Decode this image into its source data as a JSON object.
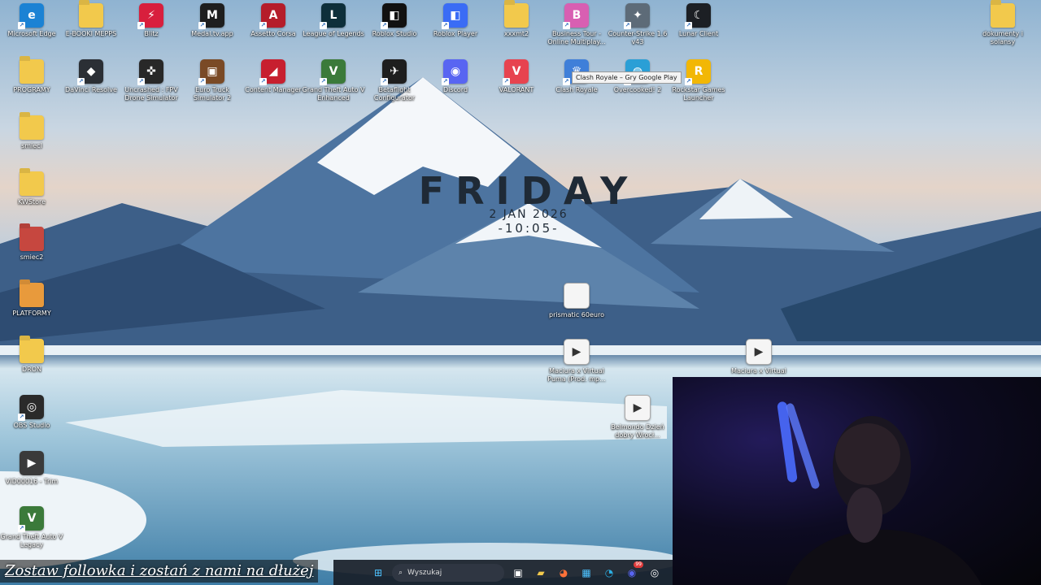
{
  "desktop": {
    "clock": {
      "day": "FRIDAY",
      "date": "2 JAN 2026",
      "time": "-10:05-"
    },
    "tooltip": "Clash Royale – Gry Google Play",
    "icons": [
      {
        "label": "Microsoft Edge",
        "icon": "edge-icon",
        "color": "#1b82d4",
        "glyph": "e"
      },
      {
        "label": "E-BOOKI MEPPS",
        "icon": "folder-icon",
        "color": "#f2c94c",
        "glyph": ""
      },
      {
        "label": "Blitz",
        "icon": "blitz-icon",
        "color": "#d81f3d",
        "glyph": "⚡"
      },
      {
        "label": "Medal.tv.app",
        "icon": "medal-icon",
        "color": "#1e1e1e",
        "glyph": "M"
      },
      {
        "label": "Assetto Corsa",
        "icon": "assetto-corsa-icon",
        "color": "#b51d2a",
        "glyph": "A"
      },
      {
        "label": "League of Legends",
        "icon": "league-icon",
        "color": "#0e2f3a",
        "glyph": "L"
      },
      {
        "label": "Roblox Studio",
        "icon": "roblox-studio-icon",
        "color": "#111111",
        "glyph": "◧"
      },
      {
        "label": "Roblox Player",
        "icon": "roblox-player-icon",
        "color": "#3a6cf5",
        "glyph": "◧"
      },
      {
        "label": "xxxmt2",
        "icon": "folder-icon",
        "color": "#f2c94c",
        "glyph": ""
      },
      {
        "label": "Business Tour - Online Multiplay...",
        "icon": "business-tour-icon",
        "color": "#d85fb2",
        "glyph": "B"
      },
      {
        "label": "Counter-Strike 1.6 v43",
        "icon": "counter-strike-icon",
        "color": "#5d6b78",
        "glyph": "✦"
      },
      {
        "label": "Lunar Client",
        "icon": "lunar-client-icon",
        "color": "#1c1f24",
        "glyph": "☾"
      },
      {
        "label": "PROGRAMY",
        "icon": "folder-icon",
        "color": "#f2c94c",
        "glyph": ""
      },
      {
        "label": "DaVinci Resolve",
        "icon": "davinci-icon",
        "color": "#2b2f35",
        "glyph": "◆"
      },
      {
        "label": "Uncrashed : FPV Drone Simulator",
        "icon": "uncrashed-icon",
        "color": "#282828",
        "glyph": "✜"
      },
      {
        "label": "Euro Truck Simulator 2",
        "icon": "ets2-icon",
        "color": "#7a4a26",
        "glyph": "▣"
      },
      {
        "label": "Content Manager",
        "icon": "content-manager-icon",
        "color": "#c71f2f",
        "glyph": "◢"
      },
      {
        "label": "Grand Theft Auto V Enhanced",
        "icon": "gta5-icon",
        "color": "#3b7a3a",
        "glyph": "V"
      },
      {
        "label": "Betaflight Configurator",
        "icon": "betaflight-icon",
        "color": "#1e1e1e",
        "glyph": "✈"
      },
      {
        "label": "Discord",
        "icon": "discord-icon",
        "color": "#5865f2",
        "glyph": "◉"
      },
      {
        "label": "VALORANT",
        "icon": "valorant-icon",
        "color": "#e7434f",
        "glyph": "V"
      },
      {
        "label": "Clash Royale",
        "icon": "clash-royale-icon",
        "color": "#3f7fd9",
        "glyph": "♛"
      },
      {
        "label": "Overcooked! 2",
        "icon": "overcooked-icon",
        "color": "#2a9fd6",
        "glyph": "◍"
      },
      {
        "label": "Rockstar Games Launcher",
        "icon": "rockstar-icon",
        "color": "#f2b705",
        "glyph": "R"
      },
      {
        "label": "smiecI",
        "icon": "folder-icon",
        "color": "#f2c94c",
        "glyph": ""
      },
      {
        "label": "KWStore",
        "icon": "folder-icon",
        "color": "#f2c94c",
        "glyph": ""
      },
      {
        "label": "smiec2",
        "icon": "image-folder-icon",
        "color": "#c6473f",
        "glyph": ""
      },
      {
        "label": "PLATFORMY",
        "icon": "platform-folder-icon",
        "color": "#e89a3c",
        "glyph": ""
      },
      {
        "label": "DRON",
        "icon": "folder-icon",
        "color": "#f2c94c",
        "glyph": ""
      },
      {
        "label": "OBS Studio",
        "icon": "obs-icon",
        "color": "#2a2a2a",
        "glyph": "◎"
      },
      {
        "label": "VID00016 - Trim",
        "icon": "video-file-icon",
        "color": "#3a3a3a",
        "glyph": "▶"
      },
      {
        "label": "Grand Theft Auto V Legacy",
        "icon": "gta5-legacy-icon",
        "color": "#3b7a3a",
        "glyph": "V"
      },
      {
        "label": "dokumenty i solansy",
        "icon": "folder-icon",
        "color": "#f2c94c",
        "glyph": ""
      },
      {
        "label": "prismatic 60euro",
        "icon": "text-file-icon",
        "color": "#f5f5f5",
        "glyph": ""
      },
      {
        "label": "Maciura x Virtual Puma (Prod. mp...",
        "icon": "media-file-icon",
        "color": "#f5f5f5",
        "glyph": "▶"
      },
      {
        "label": "Maciura x Virtual",
        "icon": "media-file-icon",
        "color": "#f5f5f5",
        "glyph": "▶"
      },
      {
        "label": "Belmondo Dzień dobry Wrocł...",
        "icon": "media-file-icon",
        "color": "#f5f5f5",
        "glyph": "▶"
      }
    ]
  },
  "caption": "Zostaw followka i zostań z nami na dłużej",
  "taskbar": {
    "search_placeholder": "Wyszukaj",
    "items": [
      {
        "name": "start-button",
        "icon": "windows-icon",
        "glyph": "⊞",
        "color": "#4cc2ff"
      },
      {
        "name": "task-view-button",
        "icon": "task-view-icon",
        "glyph": "▣",
        "color": "#ffffff"
      },
      {
        "name": "file-explorer-button",
        "icon": "folder-icon",
        "glyph": "▰",
        "color": "#f2c94c"
      },
      {
        "name": "firefox-button",
        "icon": "firefox-icon",
        "glyph": "◕",
        "color": "#ff7139"
      },
      {
        "name": "store-button",
        "icon": "store-icon",
        "glyph": "▦",
        "color": "#4cc2ff"
      },
      {
        "name": "edge-button",
        "icon": "edge-icon",
        "glyph": "◔",
        "color": "#2bb0e6"
      },
      {
        "name": "discord-button",
        "icon": "discord-icon",
        "glyph": "◉",
        "color": "#5865f2",
        "badge": "99"
      },
      {
        "name": "obs-button",
        "icon": "obs-icon",
        "glyph": "◎",
        "color": "#ffffff"
      }
    ]
  }
}
